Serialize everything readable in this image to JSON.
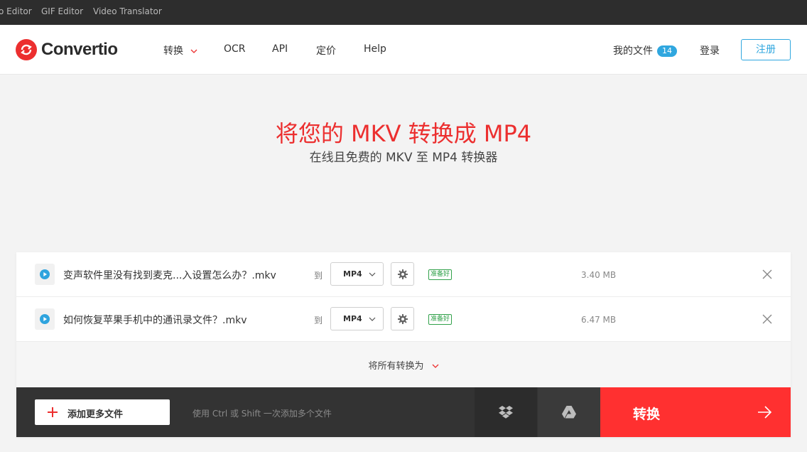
{
  "top_links": [
    "o Editor",
    "GIF Editor",
    "Video Translator"
  ],
  "brand": {
    "name": "Convertio",
    "color": "#ec2f2f",
    "icon": "convertio-logo-icon"
  },
  "nav": {
    "convert": "转换",
    "ocr": "OCR",
    "api": "API",
    "pricing": "定价",
    "help": "Help",
    "my_files": "我的文件",
    "my_files_count": "14",
    "login": "登录",
    "signup": "注册"
  },
  "hero": {
    "title": "将您的 MKV 转换成 MP4",
    "subtitle": "在线且免费的 MKV 至 MP4 转换器"
  },
  "files": [
    {
      "name": "变声软件里没有找到麦克...入设置怎么办？.mkv",
      "to_label": "到",
      "format": "MP4",
      "status": "准备好",
      "size": "3.40 MB"
    },
    {
      "name": "如何恢复苹果手机中的通讯录文件？.mkv",
      "to_label": "到",
      "format": "MP4",
      "status": "准备好",
      "size": "6.47 MB"
    }
  ],
  "convert_all_label": "将所有转换为",
  "bottom": {
    "add_more": "添加更多文件",
    "hint": "使用 Ctrl 或 Shift 一次添加多个文件",
    "convert": "转换"
  },
  "colors": {
    "accent": "#ff3030",
    "link": "#30a7df",
    "ready": "#31a14a"
  }
}
